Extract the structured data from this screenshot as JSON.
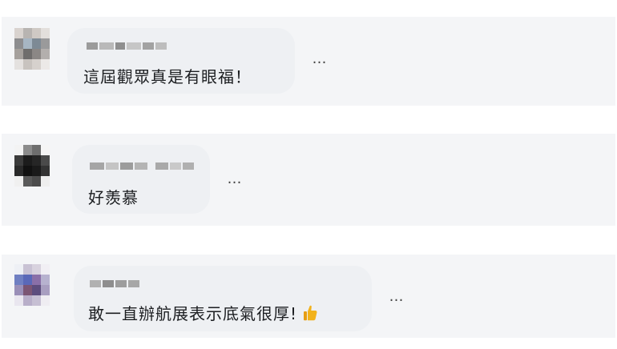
{
  "comments": [
    {
      "text": "這屆觀眾真是有眼福！",
      "more": "…"
    },
    {
      "text": "好羨慕",
      "more": "…"
    },
    {
      "text": "敢一直辦航展表示底氣很厚!",
      "emoji": "thumbs-up-icon",
      "more": "…"
    }
  ],
  "colors": {
    "card_background": "#f4f5f7",
    "bubble_background": "#eef0f3",
    "text": "#1c1e21",
    "thumb": "#f2b21b"
  }
}
